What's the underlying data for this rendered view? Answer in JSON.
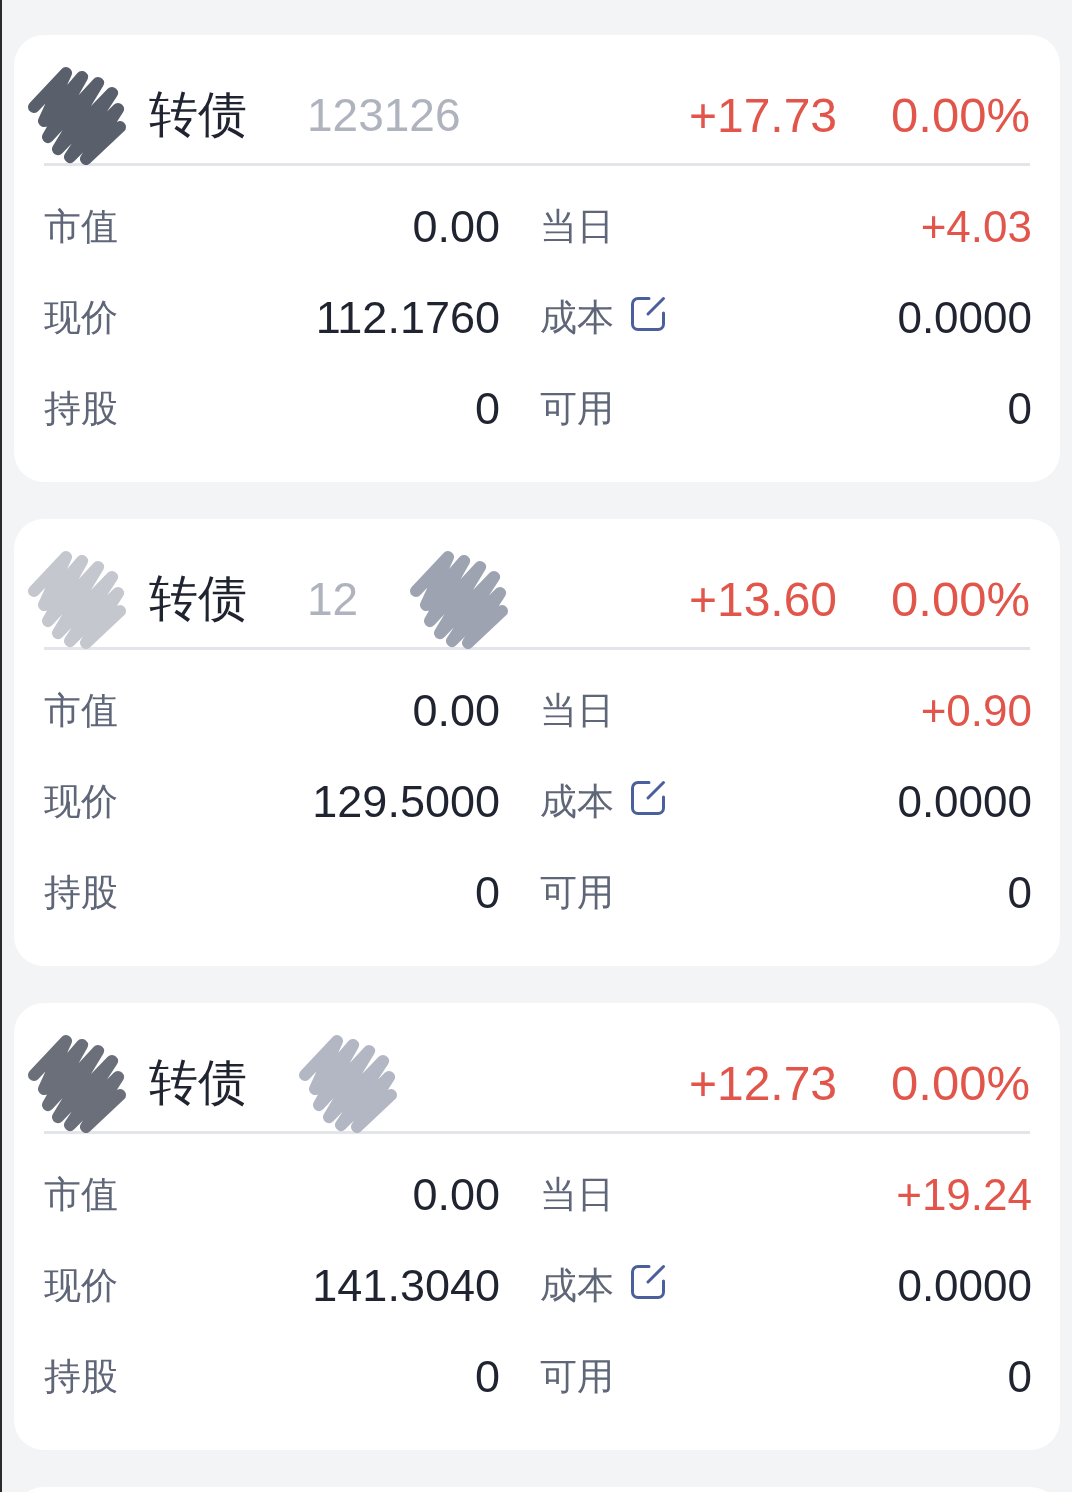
{
  "cards": [
    {
      "title": [
        {
          "kind": "scribble",
          "color": "#5a5f6c"
        },
        {
          "kind": "name",
          "text": "转债"
        },
        {
          "kind": "code",
          "text": "123126"
        }
      ],
      "change": {
        "text": "+17.73",
        "color": "#e2554a"
      },
      "change_pct": {
        "text": "0.00%",
        "color": "#e2554a"
      },
      "metrics": [
        {
          "label": "市值",
          "value": "0.00",
          "color": "#1f2430",
          "editable": false
        },
        {
          "label": "当日",
          "value": "+4.03",
          "color": "#e2554a",
          "editable": false
        },
        {
          "label": "现价",
          "value": "112.1760",
          "color": "#1f2430",
          "editable": false
        },
        {
          "label": "成本",
          "value": "0.0000",
          "color": "#1f2430",
          "editable": true
        },
        {
          "label": "持股",
          "value": "0",
          "color": "#1f2430",
          "editable": false
        },
        {
          "label": "可用",
          "value": "0",
          "color": "#1f2430",
          "editable": false
        }
      ]
    },
    {
      "title": [
        {
          "kind": "scribble",
          "color": "#c4c7ce"
        },
        {
          "kind": "name",
          "text": "转债"
        },
        {
          "kind": "code",
          "text": "12"
        },
        {
          "kind": "scribble",
          "color": "#9ea3b2"
        }
      ],
      "change": {
        "text": "+13.60",
        "color": "#e2554a"
      },
      "change_pct": {
        "text": "0.00%",
        "color": "#e2554a"
      },
      "metrics": [
        {
          "label": "市值",
          "value": "0.00",
          "color": "#1f2430",
          "editable": false
        },
        {
          "label": "当日",
          "value": "+0.90",
          "color": "#e2554a",
          "editable": false
        },
        {
          "label": "现价",
          "value": "129.5000",
          "color": "#1f2430",
          "editable": false
        },
        {
          "label": "成本",
          "value": "0.0000",
          "color": "#1f2430",
          "editable": true
        },
        {
          "label": "持股",
          "value": "0",
          "color": "#1f2430",
          "editable": false
        },
        {
          "label": "可用",
          "value": "0",
          "color": "#1f2430",
          "editable": false
        }
      ]
    },
    {
      "title": [
        {
          "kind": "scribble",
          "color": "#6b6f7a"
        },
        {
          "kind": "name",
          "text": "转债"
        },
        {
          "kind": "scribble",
          "color": "#b3b7c3"
        }
      ],
      "change": {
        "text": "+12.73",
        "color": "#e2554a"
      },
      "change_pct": {
        "text": "0.00%",
        "color": "#e2554a"
      },
      "metrics": [
        {
          "label": "市值",
          "value": "0.00",
          "color": "#1f2430",
          "editable": false
        },
        {
          "label": "当日",
          "value": "+19.24",
          "color": "#e2554a",
          "editable": false
        },
        {
          "label": "现价",
          "value": "141.3040",
          "color": "#1f2430",
          "editable": false
        },
        {
          "label": "成本",
          "value": "0.0000",
          "color": "#1f2430",
          "editable": true
        },
        {
          "label": "持股",
          "value": "0",
          "color": "#1f2430",
          "editable": false
        },
        {
          "label": "可用",
          "value": "0",
          "color": "#1f2430",
          "editable": false
        }
      ]
    }
  ],
  "partial_card_below": true
}
